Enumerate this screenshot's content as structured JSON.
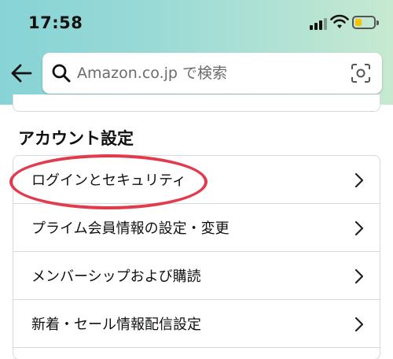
{
  "status_bar": {
    "time": "17:58"
  },
  "search": {
    "placeholder": "Amazon.co.jp で検索"
  },
  "section": {
    "title": "アカウント設定"
  },
  "menu": {
    "items": [
      {
        "label": "ログインとセキュリティ"
      },
      {
        "label": "プライム会員情報の設定・変更"
      },
      {
        "label": "メンバーシップおよび購読"
      },
      {
        "label": "新着・セール情報配信設定"
      }
    ]
  },
  "colors": {
    "header_gradient_start": "#87d3d6",
    "header_gradient_end": "#c7e9d0",
    "highlight": "#e23b4e",
    "divider": "#d5d9d9",
    "battery": "#f2c500"
  },
  "icons": {
    "back": "arrow-left-icon",
    "search": "magnifier-icon",
    "camera": "camera-scan-icon",
    "mic": "microphone-icon",
    "chevron": "chevron-right-icon"
  }
}
